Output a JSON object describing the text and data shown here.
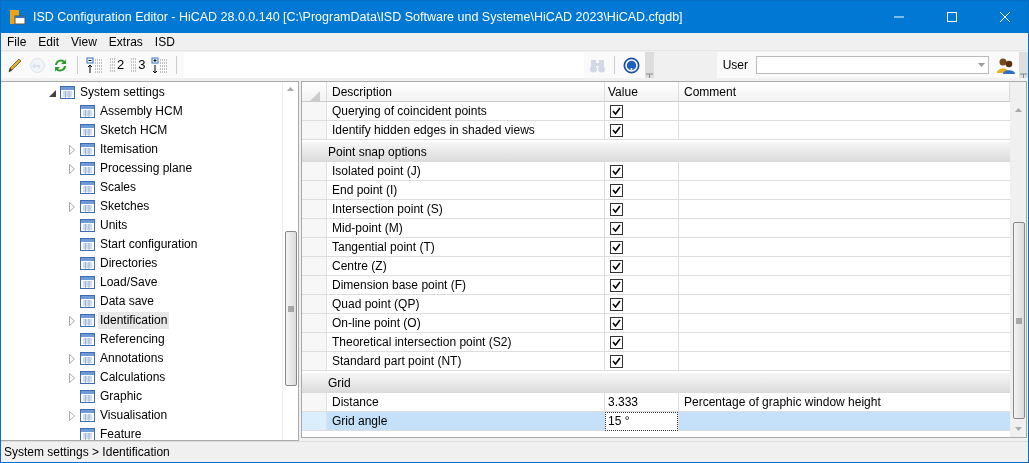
{
  "window": {
    "title": "ISD Configuration Editor  - HiCAD 28.0.0.140 [C:\\ProgramData\\ISD Software und Systeme\\HiCAD 2023\\HiCAD.cfgdb]"
  },
  "menu": [
    "File",
    "Edit",
    "View",
    "Extras",
    "ISD"
  ],
  "toolbar": {
    "buttons": [
      {
        "kind": "pencil",
        "disabled": false
      },
      {
        "kind": "undo",
        "disabled": true
      },
      {
        "kind": "refresh",
        "disabled": false
      },
      {
        "kind": "collapse",
        "disabled": false
      },
      {
        "kind": "level",
        "label": "2",
        "disabled": false
      },
      {
        "kind": "level",
        "label": "3",
        "disabled": false
      },
      {
        "kind": "expand",
        "disabled": false
      }
    ],
    "right_buttons": [
      {
        "kind": "find",
        "disabled": true
      },
      {
        "kind": "help",
        "disabled": false
      }
    ],
    "user_label": "User"
  },
  "tree": {
    "label": "System settings",
    "expanded": true,
    "children": [
      {
        "label": "Assembly HCM",
        "has_children": false,
        "selected": false
      },
      {
        "label": "Sketch HCM",
        "has_children": false,
        "selected": false
      },
      {
        "label": "Itemisation",
        "has_children": true,
        "selected": false
      },
      {
        "label": "Processing plane",
        "has_children": true,
        "selected": false
      },
      {
        "label": "Scales",
        "has_children": false,
        "selected": false
      },
      {
        "label": "Sketches",
        "has_children": true,
        "selected": false
      },
      {
        "label": "Units",
        "has_children": false,
        "selected": false
      },
      {
        "label": "Start configuration",
        "has_children": false,
        "selected": false
      },
      {
        "label": "Directories",
        "has_children": false,
        "selected": false
      },
      {
        "label": "Load/Save",
        "has_children": false,
        "selected": false
      },
      {
        "label": "Data save",
        "has_children": false,
        "selected": false
      },
      {
        "label": "Identification",
        "has_children": true,
        "selected": true
      },
      {
        "label": "Referencing",
        "has_children": false,
        "selected": false
      },
      {
        "label": "Annotations",
        "has_children": true,
        "selected": false
      },
      {
        "label": "Calculations",
        "has_children": true,
        "selected": false
      },
      {
        "label": "Graphic",
        "has_children": false,
        "selected": false
      },
      {
        "label": "Visualisation",
        "has_children": true,
        "selected": false
      },
      {
        "label": "Feature",
        "has_children": false,
        "selected": false
      }
    ]
  },
  "grid": {
    "columns": [
      "Description",
      "Value",
      "Comment"
    ],
    "rows": [
      {
        "kind": "checkbox",
        "description": "Querying of coincident points",
        "checked": true,
        "selected": false
      },
      {
        "kind": "checkbox",
        "description": "Identify hidden edges in shaded views",
        "checked": true,
        "selected": false
      },
      {
        "kind": "group",
        "label": "Point snap options"
      },
      {
        "kind": "checkbox",
        "description": "Isolated point (J)",
        "checked": true,
        "selected": false
      },
      {
        "kind": "checkbox",
        "description": "End point (I)",
        "checked": true,
        "selected": false
      },
      {
        "kind": "checkbox",
        "description": "Intersection point (S)",
        "checked": true,
        "selected": false
      },
      {
        "kind": "checkbox",
        "description": "Mid-point (M)",
        "checked": true,
        "selected": false
      },
      {
        "kind": "checkbox",
        "description": "Tangential point (T)",
        "checked": true,
        "selected": false
      },
      {
        "kind": "checkbox",
        "description": "Centre (Z)",
        "checked": true,
        "selected": false
      },
      {
        "kind": "checkbox",
        "description": "Dimension base point (F)",
        "checked": true,
        "selected": false
      },
      {
        "kind": "checkbox",
        "description": "Quad point (QP)",
        "checked": true,
        "selected": false
      },
      {
        "kind": "checkbox",
        "description": "On-line point (O)",
        "checked": true,
        "selected": false
      },
      {
        "kind": "checkbox",
        "description": "Theoretical intersection point (S2)",
        "checked": true,
        "selected": false
      },
      {
        "kind": "checkbox",
        "description": "Standard part point (NT)",
        "checked": true,
        "selected": false
      },
      {
        "kind": "group",
        "label": "Grid"
      },
      {
        "kind": "text",
        "description": "Distance",
        "value": "3.333",
        "comment": "Percentage of graphic window height",
        "selected": false
      },
      {
        "kind": "text",
        "description": "Grid angle",
        "value": "15 °",
        "selected": true
      }
    ]
  },
  "status_bar": "System settings > Identification"
}
